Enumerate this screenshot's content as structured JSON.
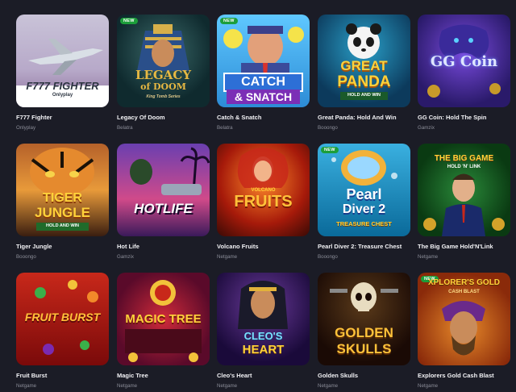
{
  "badge_label": "NEW",
  "games": [
    {
      "name": "F777 Fighter",
      "provider": "Onlyplay",
      "art_title": "F777 FIGHTER",
      "art_sub": "Onlyplay",
      "is_new": false
    },
    {
      "name": "Legacy Of Doom",
      "provider": "Belatra",
      "art_title": "LEGACY",
      "art_title2": "of DOOM",
      "art_sub": "King Tomb Series",
      "is_new": true
    },
    {
      "name": "Catch & Snatch",
      "provider": "Belatra",
      "art_title": "CATCH",
      "art_title2": "& SNATCH",
      "is_new": true
    },
    {
      "name": "Great Panda: Hold And Win",
      "provider": "Booongo",
      "art_title": "GREAT",
      "art_title2": "PANDA",
      "art_sub": "HOLD AND WIN",
      "is_new": false
    },
    {
      "name": "GG Coin: Hold The Spin",
      "provider": "Gamzix",
      "art_title": "GG Coin",
      "is_new": false
    },
    {
      "name": "Tiger Jungle",
      "provider": "Booongo",
      "art_title": "TIGER",
      "art_title2": "JUNGLE",
      "art_sub": "HOLD AND WIN",
      "is_new": false
    },
    {
      "name": "Hot Life",
      "provider": "Gamzix",
      "art_title": "HOTLIFE",
      "is_new": false
    },
    {
      "name": "Volcano Fruits",
      "provider": "Netgame",
      "art_title": "FRUITS",
      "art_sub": "VOLCANO",
      "is_new": false
    },
    {
      "name": "Pearl Diver 2: Treasure Chest",
      "provider": "Booongo",
      "art_title": "Pearl",
      "art_title2": "Diver 2",
      "art_sub": "TREASURE CHEST",
      "is_new": true
    },
    {
      "name": "The Big Game Hold'N'Link",
      "provider": "Netgame",
      "art_title": "THE BIG GAME",
      "art_sub": "HOLD 'N' LINK",
      "is_new": false
    },
    {
      "name": "Fruit Burst",
      "provider": "Netgame",
      "art_title": "FRUIT BURST",
      "is_new": false
    },
    {
      "name": "Magic Tree",
      "provider": "Netgame",
      "art_title": "MAGIC TREE",
      "is_new": false
    },
    {
      "name": "Cleo's Heart",
      "provider": "Netgame",
      "art_title": "CLEO'S",
      "art_title2": "HEART",
      "is_new": false
    },
    {
      "name": "Golden Skulls",
      "provider": "Netgame",
      "art_title": "GOLDEN",
      "art_title2": "SKULLS",
      "is_new": false
    },
    {
      "name": "Explorers Gold Cash Blast",
      "provider": "Netgame",
      "art_title": "XPLORER'S GOLD",
      "art_sub": "CASH BLAST",
      "is_new": true
    }
  ],
  "colors": {
    "background": "#1b1c26",
    "text": "#f2f2f5",
    "muted": "#8b8d98",
    "badge": "#1c9e3a"
  }
}
